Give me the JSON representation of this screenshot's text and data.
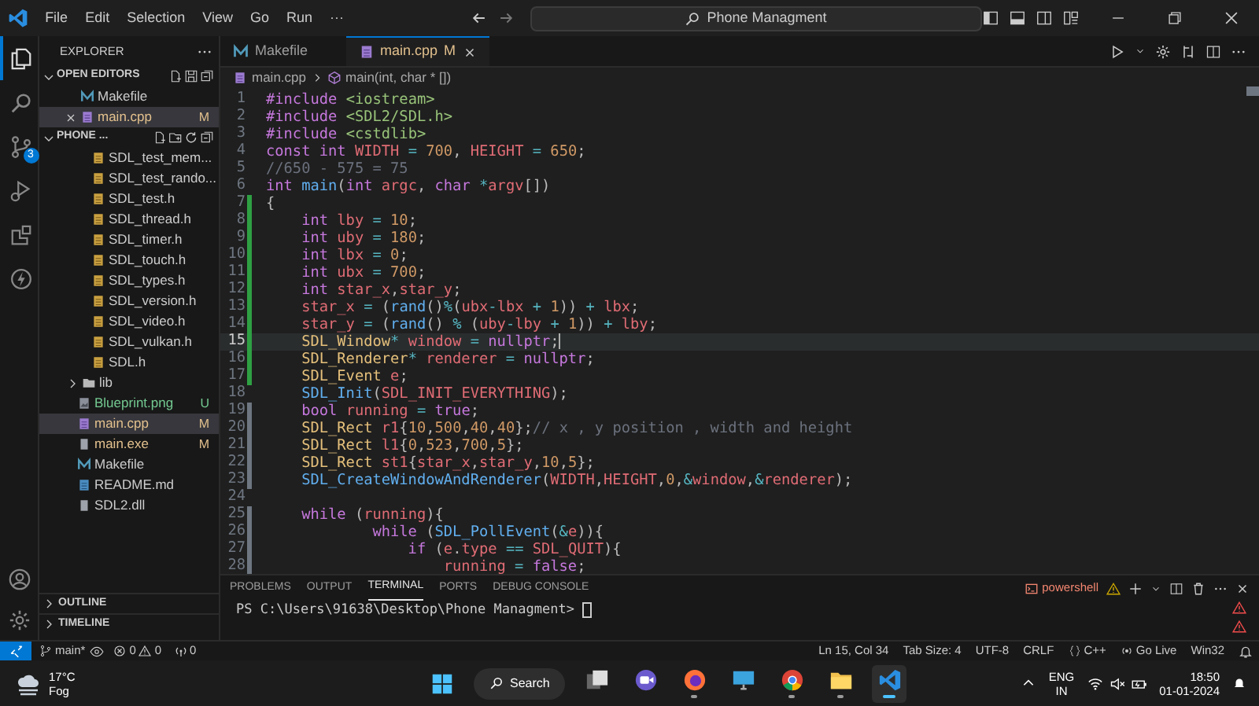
{
  "title_bar": {
    "menu": [
      "File",
      "Edit",
      "Selection",
      "View",
      "Go",
      "Run",
      "···"
    ],
    "search": "Phone Managment"
  },
  "activity_bar": {
    "items": [
      {
        "kind": "explorer",
        "selected": true
      },
      {
        "kind": "search",
        "selected": false
      },
      {
        "kind": "source-control",
        "selected": false,
        "badge": "3"
      },
      {
        "kind": "run",
        "selected": false
      },
      {
        "kind": "extensions",
        "selected": false
      },
      {
        "kind": "lightning",
        "selected": false
      }
    ]
  },
  "sidebar": {
    "title": "EXPLORER",
    "open_editors": {
      "label": "OPEN EDITORS",
      "items": [
        {
          "kind": "make",
          "name": "Makefile",
          "selected": false
        },
        {
          "kind": "cpp",
          "name": "main.cpp",
          "badge": "M",
          "untracked": false,
          "selected": true
        }
      ]
    },
    "folder": {
      "label": "PHONE ...",
      "items": [
        {
          "kind": "header",
          "name": "SDL_test_mem...",
          "selected": false
        },
        {
          "kind": "header",
          "name": "SDL_test_rando...",
          "selected": false
        },
        {
          "kind": "header",
          "name": "SDL_test.h",
          "selected": false
        },
        {
          "kind": "header",
          "name": "SDL_thread.h",
          "selected": false
        },
        {
          "kind": "header",
          "name": "SDL_timer.h",
          "selected": false
        },
        {
          "kind": "header",
          "name": "SDL_touch.h",
          "selected": false
        },
        {
          "kind": "header",
          "name": "SDL_types.h",
          "selected": false
        },
        {
          "kind": "header",
          "name": "SDL_version.h",
          "selected": false
        },
        {
          "kind": "header",
          "name": "SDL_video.h",
          "selected": false
        },
        {
          "kind": "header",
          "name": "SDL_vulkan.h",
          "selected": false
        },
        {
          "kind": "header",
          "name": "SDL.h",
          "selected": false
        },
        {
          "kind": "folder",
          "name": "lib",
          "selected": false
        },
        {
          "kind": "image",
          "name": "Blueprint.png",
          "badge": "U",
          "untracked": true,
          "selected": false
        },
        {
          "kind": "cpp",
          "name": "main.cpp",
          "badge": "M",
          "untracked": false,
          "selected": true
        },
        {
          "kind": "binary",
          "name": "main.exe",
          "badge": "M",
          "untracked": false,
          "selected": false
        },
        {
          "kind": "make",
          "name": "Makefile",
          "selected": false
        },
        {
          "kind": "markdown",
          "name": "README.md",
          "selected": false
        },
        {
          "kind": "binary",
          "name": "SDL2.dll",
          "selected": false
        }
      ]
    },
    "sections": [
      "OUTLINE",
      "TIMELINE"
    ]
  },
  "editor": {
    "tabs": [
      {
        "kind": "make",
        "label": "Makefile",
        "selected": false
      },
      {
        "kind": "cpp",
        "label": "main.cpp",
        "badge": "M",
        "selected": true
      }
    ],
    "breadcrumb": [
      "main.cpp",
      "main(int, char * [])"
    ],
    "lines": [
      {
        "no": "1",
        "current": false,
        "added": false,
        "modified": false,
        "tokens": [
          {
            "kind": "kw",
            "text": "#include "
          },
          {
            "kind": "str",
            "text": "<iostream>"
          }
        ]
      },
      {
        "no": "2",
        "current": false,
        "added": false,
        "modified": false,
        "tokens": [
          {
            "kind": "kw",
            "text": "#include "
          },
          {
            "kind": "str",
            "text": "<SDL2/SDL.h>"
          }
        ]
      },
      {
        "no": "3",
        "current": false,
        "added": false,
        "modified": false,
        "tokens": [
          {
            "kind": "kw",
            "text": "#include "
          },
          {
            "kind": "str",
            "text": "<cstdlib>"
          }
        ]
      },
      {
        "no": "4",
        "current": false,
        "added": false,
        "modified": false,
        "tokens": [
          {
            "kind": "kw",
            "text": "const int "
          },
          {
            "kind": "const",
            "text": "WIDTH"
          },
          {
            "kind": "op",
            "text": " = "
          },
          {
            "kind": "num",
            "text": "700"
          },
          {
            "kind": "pl",
            "text": ", "
          },
          {
            "kind": "const",
            "text": "HEIGHT"
          },
          {
            "kind": "op",
            "text": " = "
          },
          {
            "kind": "num",
            "text": "650"
          },
          {
            "kind": "pl",
            "text": ";"
          }
        ]
      },
      {
        "no": "5",
        "current": false,
        "added": false,
        "modified": false,
        "tokens": [
          {
            "kind": "cm",
            "text": "//650 - 575 = 75"
          }
        ]
      },
      {
        "no": "6",
        "current": false,
        "added": false,
        "modified": false,
        "tokens": [
          {
            "kind": "kw",
            "text": "int "
          },
          {
            "kind": "fn",
            "text": "main"
          },
          {
            "kind": "pl",
            "text": "("
          },
          {
            "kind": "kw",
            "text": "int "
          },
          {
            "kind": "var",
            "text": "argc"
          },
          {
            "kind": "pl",
            "text": ", "
          },
          {
            "kind": "kw",
            "text": "char "
          },
          {
            "kind": "op",
            "text": "*"
          },
          {
            "kind": "var",
            "text": "argv"
          },
          {
            "kind": "pl",
            "text": "[])"
          }
        ]
      },
      {
        "no": "7",
        "current": false,
        "added": true,
        "modified": false,
        "tokens": [
          {
            "kind": "pl",
            "text": "{"
          }
        ]
      },
      {
        "no": "8",
        "current": false,
        "added": true,
        "modified": false,
        "tokens": [
          {
            "kind": "kw",
            "text": "    int "
          },
          {
            "kind": "var",
            "text": "lby"
          },
          {
            "kind": "op",
            "text": " = "
          },
          {
            "kind": "num",
            "text": "10"
          },
          {
            "kind": "pl",
            "text": ";"
          }
        ]
      },
      {
        "no": "9",
        "current": false,
        "added": true,
        "modified": false,
        "tokens": [
          {
            "kind": "kw",
            "text": "    int "
          },
          {
            "kind": "var",
            "text": "uby"
          },
          {
            "kind": "op",
            "text": " = "
          },
          {
            "kind": "num",
            "text": "180"
          },
          {
            "kind": "pl",
            "text": ";"
          }
        ]
      },
      {
        "no": "10",
        "current": false,
        "added": true,
        "modified": false,
        "tokens": [
          {
            "kind": "kw",
            "text": "    int "
          },
          {
            "kind": "var",
            "text": "lbx"
          },
          {
            "kind": "op",
            "text": " = "
          },
          {
            "kind": "num",
            "text": "0"
          },
          {
            "kind": "pl",
            "text": ";"
          }
        ]
      },
      {
        "no": "11",
        "current": false,
        "added": true,
        "modified": false,
        "tokens": [
          {
            "kind": "kw",
            "text": "    int "
          },
          {
            "kind": "var",
            "text": "ubx"
          },
          {
            "kind": "op",
            "text": " = "
          },
          {
            "kind": "num",
            "text": "700"
          },
          {
            "kind": "pl",
            "text": ";"
          }
        ]
      },
      {
        "no": "12",
        "current": false,
        "added": true,
        "modified": false,
        "tokens": [
          {
            "kind": "kw",
            "text": "    int "
          },
          {
            "kind": "var",
            "text": "star_x"
          },
          {
            "kind": "pl",
            "text": ","
          },
          {
            "kind": "var",
            "text": "star_y"
          },
          {
            "kind": "pl",
            "text": ";"
          }
        ]
      },
      {
        "no": "13",
        "current": false,
        "added": true,
        "modified": false,
        "tokens": [
          {
            "kind": "var",
            "text": "    star_x"
          },
          {
            "kind": "op",
            "text": " = "
          },
          {
            "kind": "pl",
            "text": "("
          },
          {
            "kind": "fn",
            "text": "rand"
          },
          {
            "kind": "pl",
            "text": "()"
          },
          {
            "kind": "op",
            "text": "%"
          },
          {
            "kind": "pl",
            "text": "("
          },
          {
            "kind": "var",
            "text": "ubx"
          },
          {
            "kind": "op",
            "text": "-"
          },
          {
            "kind": "var",
            "text": "lbx"
          },
          {
            "kind": "op",
            "text": " + "
          },
          {
            "kind": "num",
            "text": "1"
          },
          {
            "kind": "pl",
            "text": ")) "
          },
          {
            "kind": "op",
            "text": "+ "
          },
          {
            "kind": "var",
            "text": "lbx"
          },
          {
            "kind": "pl",
            "text": ";"
          }
        ]
      },
      {
        "no": "14",
        "current": false,
        "added": true,
        "modified": false,
        "tokens": [
          {
            "kind": "var",
            "text": "    star_y"
          },
          {
            "kind": "op",
            "text": " = "
          },
          {
            "kind": "pl",
            "text": "("
          },
          {
            "kind": "fn",
            "text": "rand"
          },
          {
            "kind": "pl",
            "text": "() "
          },
          {
            "kind": "op",
            "text": "% "
          },
          {
            "kind": "pl",
            "text": "("
          },
          {
            "kind": "var",
            "text": "uby"
          },
          {
            "kind": "op",
            "text": "-"
          },
          {
            "kind": "var",
            "text": "lby"
          },
          {
            "kind": "op",
            "text": " + "
          },
          {
            "kind": "num",
            "text": "1"
          },
          {
            "kind": "pl",
            "text": ")) "
          },
          {
            "kind": "op",
            "text": "+ "
          },
          {
            "kind": "var",
            "text": "lby"
          },
          {
            "kind": "pl",
            "text": ";"
          }
        ]
      },
      {
        "no": "15",
        "current": true,
        "added": true,
        "modified": false,
        "tokens": [
          {
            "kind": "type",
            "text": "    SDL_Window"
          },
          {
            "kind": "op",
            "text": "* "
          },
          {
            "kind": "var",
            "text": "window"
          },
          {
            "kind": "op",
            "text": " = "
          },
          {
            "kind": "kw",
            "text": "nullptr"
          },
          {
            "kind": "pl",
            "text": ";"
          }
        ]
      },
      {
        "no": "16",
        "current": false,
        "added": true,
        "modified": false,
        "tokens": [
          {
            "kind": "type",
            "text": "    SDL_Renderer"
          },
          {
            "kind": "op",
            "text": "* "
          },
          {
            "kind": "var",
            "text": "renderer"
          },
          {
            "kind": "op",
            "text": " = "
          },
          {
            "kind": "kw",
            "text": "nullptr"
          },
          {
            "kind": "pl",
            "text": ";"
          }
        ]
      },
      {
        "no": "17",
        "current": false,
        "added": true,
        "modified": false,
        "tokens": [
          {
            "kind": "type",
            "text": "    SDL_Event "
          },
          {
            "kind": "var",
            "text": "e"
          },
          {
            "kind": "pl",
            "text": ";"
          }
        ]
      },
      {
        "no": "18",
        "current": false,
        "added": false,
        "modified": false,
        "tokens": [
          {
            "kind": "fn",
            "text": "    SDL_Init"
          },
          {
            "kind": "pl",
            "text": "("
          },
          {
            "kind": "const",
            "text": "SDL_INIT_EVERYTHING"
          },
          {
            "kind": "pl",
            "text": ");"
          }
        ]
      },
      {
        "no": "19",
        "current": false,
        "added": false,
        "modified": true,
        "tokens": [
          {
            "kind": "kw",
            "text": "    bool "
          },
          {
            "kind": "var",
            "text": "running"
          },
          {
            "kind": "op",
            "text": " = "
          },
          {
            "kind": "kw",
            "text": "true"
          },
          {
            "kind": "pl",
            "text": ";"
          }
        ]
      },
      {
        "no": "20",
        "current": false,
        "added": false,
        "modified": true,
        "tokens": [
          {
            "kind": "type",
            "text": "    SDL_Rect "
          },
          {
            "kind": "var",
            "text": "r1"
          },
          {
            "kind": "pl",
            "text": "{"
          },
          {
            "kind": "num",
            "text": "10"
          },
          {
            "kind": "pl",
            "text": ","
          },
          {
            "kind": "num",
            "text": "500"
          },
          {
            "kind": "pl",
            "text": ","
          },
          {
            "kind": "num",
            "text": "40"
          },
          {
            "kind": "pl",
            "text": ","
          },
          {
            "kind": "num",
            "text": "40"
          },
          {
            "kind": "pl",
            "text": "};"
          },
          {
            "kind": "cm",
            "text": "// x , y position , width and height"
          }
        ]
      },
      {
        "no": "21",
        "current": false,
        "added": false,
        "modified": true,
        "tokens": [
          {
            "kind": "type",
            "text": "    SDL_Rect "
          },
          {
            "kind": "var",
            "text": "l1"
          },
          {
            "kind": "pl",
            "text": "{"
          },
          {
            "kind": "num",
            "text": "0"
          },
          {
            "kind": "pl",
            "text": ","
          },
          {
            "kind": "num",
            "text": "523"
          },
          {
            "kind": "pl",
            "text": ","
          },
          {
            "kind": "num",
            "text": "700"
          },
          {
            "kind": "pl",
            "text": ","
          },
          {
            "kind": "num",
            "text": "5"
          },
          {
            "kind": "pl",
            "text": "};"
          }
        ]
      },
      {
        "no": "22",
        "current": false,
        "added": false,
        "modified": true,
        "tokens": [
          {
            "kind": "type",
            "text": "    SDL_Rect "
          },
          {
            "kind": "var",
            "text": "st1"
          },
          {
            "kind": "pl",
            "text": "{"
          },
          {
            "kind": "var",
            "text": "star_x"
          },
          {
            "kind": "pl",
            "text": ","
          },
          {
            "kind": "var",
            "text": "star_y"
          },
          {
            "kind": "pl",
            "text": ","
          },
          {
            "kind": "num",
            "text": "10"
          },
          {
            "kind": "pl",
            "text": ","
          },
          {
            "kind": "num",
            "text": "5"
          },
          {
            "kind": "pl",
            "text": "};"
          }
        ]
      },
      {
        "no": "23",
        "current": false,
        "added": false,
        "modified": true,
        "tokens": [
          {
            "kind": "fn",
            "text": "    SDL_CreateWindowAndRenderer"
          },
          {
            "kind": "pl",
            "text": "("
          },
          {
            "kind": "const",
            "text": "WIDTH"
          },
          {
            "kind": "pl",
            "text": ","
          },
          {
            "kind": "const",
            "text": "HEIGHT"
          },
          {
            "kind": "pl",
            "text": ","
          },
          {
            "kind": "num",
            "text": "0"
          },
          {
            "kind": "pl",
            "text": ","
          },
          {
            "kind": "op",
            "text": "&"
          },
          {
            "kind": "var",
            "text": "window"
          },
          {
            "kind": "pl",
            "text": ","
          },
          {
            "kind": "op",
            "text": "&"
          },
          {
            "kind": "var",
            "text": "renderer"
          },
          {
            "kind": "pl",
            "text": ");"
          }
        ]
      },
      {
        "no": "24",
        "current": false,
        "added": false,
        "modified": false
      },
      {
        "no": "25",
        "current": false,
        "added": false,
        "modified": true,
        "tokens": [
          {
            "kind": "kw",
            "text": "    while "
          },
          {
            "kind": "pl",
            "text": "("
          },
          {
            "kind": "var",
            "text": "running"
          },
          {
            "kind": "pl",
            "text": "){"
          }
        ]
      },
      {
        "no": "26",
        "current": false,
        "added": false,
        "modified": true,
        "tokens": [
          {
            "kind": "kw",
            "text": "            while "
          },
          {
            "kind": "pl",
            "text": "("
          },
          {
            "kind": "fn",
            "text": "SDL_PollEvent"
          },
          {
            "kind": "pl",
            "text": "("
          },
          {
            "kind": "op",
            "text": "&"
          },
          {
            "kind": "var",
            "text": "e"
          },
          {
            "kind": "pl",
            "text": ")){"
          }
        ]
      },
      {
        "no": "27",
        "current": false,
        "added": false,
        "modified": true,
        "tokens": [
          {
            "kind": "kw",
            "text": "                if "
          },
          {
            "kind": "pl",
            "text": "("
          },
          {
            "kind": "var",
            "text": "e"
          },
          {
            "kind": "pl",
            "text": "."
          },
          {
            "kind": "var",
            "text": "type"
          },
          {
            "kind": "op",
            "text": " == "
          },
          {
            "kind": "const",
            "text": "SDL_QUIT"
          },
          {
            "kind": "pl",
            "text": "){"
          }
        ]
      },
      {
        "no": "28",
        "current": false,
        "added": false,
        "modified": true,
        "tokens": [
          {
            "kind": "var",
            "text": "                    running"
          },
          {
            "kind": "op",
            "text": " = "
          },
          {
            "kind": "kw",
            "text": "false"
          },
          {
            "kind": "pl",
            "text": ";"
          }
        ]
      }
    ]
  },
  "panel": {
    "tabs": [
      {
        "label": "PROBLEMS",
        "selected": false
      },
      {
        "label": "OUTPUT",
        "selected": false
      },
      {
        "label": "TERMINAL",
        "selected": true
      },
      {
        "label": "PORTS",
        "selected": false
      },
      {
        "label": "DEBUG CONSOLE",
        "selected": false
      }
    ],
    "shell": "powershell",
    "prompt": "PS C:\\Users\\91638\\Desktop\\Phone Managment> "
  },
  "status_bar": {
    "branch": "main*",
    "errors": "0",
    "warnings": "0",
    "ports": "0",
    "right": [
      {
        "kind": "text",
        "text": "Ln 15, Col 34"
      },
      {
        "kind": "text",
        "text": "Tab Size: 4"
      },
      {
        "kind": "text",
        "text": "UTF-8"
      },
      {
        "kind": "text",
        "text": "CRLF"
      },
      {
        "kind": "language",
        "text": "C++"
      },
      {
        "kind": "live",
        "text": "Go Live"
      },
      {
        "kind": "text",
        "text": "Win32"
      }
    ]
  },
  "taskbar": {
    "temperature": "17°C",
    "weather": "Fog",
    "search": "Search",
    "apps": [
      {
        "kind": "task-view",
        "running": false,
        "selected": false
      },
      {
        "kind": "meet",
        "running": false,
        "selected": false
      },
      {
        "kind": "firefox",
        "running": true,
        "selected": false
      },
      {
        "kind": "monitor",
        "running": false,
        "selected": false
      },
      {
        "kind": "chrome",
        "running": true,
        "selected": false
      },
      {
        "kind": "files",
        "running": true,
        "selected": false
      },
      {
        "kind": "vscode",
        "running": true,
        "selected": true
      }
    ],
    "language": [
      "ENG",
      "IN"
    ],
    "time": "18:50",
    "date": "01-01-2024"
  }
}
